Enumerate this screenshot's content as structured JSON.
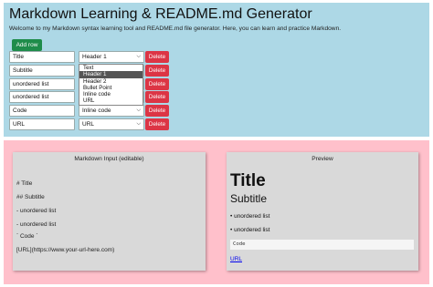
{
  "header": {
    "title": "Markdown Learning & README.md Generator",
    "intro": "Welcome to my Markdown syntax learning tool and README.md file generator. Here, you can learn and practice Markdown."
  },
  "add_row_label": "Add row",
  "delete_label": "Delete",
  "rows": [
    {
      "text": "Title",
      "type": "Header 1"
    },
    {
      "text": "Subtitle",
      "type": ""
    },
    {
      "text": "unordered list",
      "type": ""
    },
    {
      "text": "unordered list",
      "type": ""
    },
    {
      "text": "Code",
      "type": "Inline code"
    },
    {
      "text": "URL",
      "type": "URL"
    }
  ],
  "dropdown": {
    "options": [
      "Text",
      "Header 1",
      "Header 2",
      "Bullet Point",
      "Inline code",
      "URL"
    ],
    "highlighted": "Header 1"
  },
  "markdown_panel": {
    "title": "Markdown Input (editable)",
    "lines": [
      "# Title",
      "## Subtitle",
      "- unordered list",
      "- unordered list",
      "` Code `",
      "[URL](https://www.your-url-here.com)"
    ]
  },
  "preview_panel": {
    "title": "Preview",
    "h1": "Title",
    "h2": "Subtitle",
    "list_items": [
      "• unordered list",
      "• unordered list"
    ],
    "code": "Code",
    "link": "URL"
  },
  "colors": {
    "top_bg": "#add8e6",
    "bottom_bg": "#ffc0cb",
    "add_button": "#1e8c4a",
    "delete_button": "#dc3545",
    "panel_bg": "#d9d9d9"
  },
  "icons": {
    "select_arrow": "chevron-down-icon"
  }
}
